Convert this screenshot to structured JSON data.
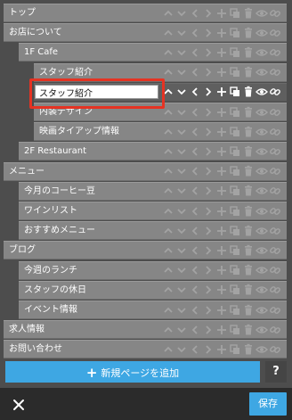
{
  "tree": [
    {
      "label": "トップ",
      "indent": 0
    },
    {
      "label": "お店について",
      "indent": 0
    },
    {
      "label": "1F Cafe",
      "indent": 1
    },
    {
      "label": "スタッフ紹介",
      "indent": 2
    },
    {
      "label": "",
      "indent": 2,
      "editing": true
    },
    {
      "label": "内装デザイン",
      "indent": 2
    },
    {
      "label": "映画タイアップ情報",
      "indent": 2
    },
    {
      "label": "2F Restaurant",
      "indent": 1
    },
    {
      "label": "メニュー",
      "indent": 0
    },
    {
      "label": "今月のコーヒー豆",
      "indent": 1
    },
    {
      "label": "ワインリスト",
      "indent": 1
    },
    {
      "label": "おすすめメニュー",
      "indent": 1
    },
    {
      "label": "ブログ",
      "indent": 0
    },
    {
      "label": "今週のランチ",
      "indent": 1
    },
    {
      "label": "スタッフの休日",
      "indent": 1
    },
    {
      "label": "イベント情報",
      "indent": 1
    },
    {
      "label": "求人情報",
      "indent": 0
    },
    {
      "label": "お問い合わせ",
      "indent": 0
    }
  ],
  "edit": {
    "value": "スタッフ紹介"
  },
  "actions": {
    "add_page_label": "新規ページを追加",
    "help_label": "?",
    "save_label": "保存"
  },
  "colors": {
    "accent": "#3ea7e3",
    "highlight": "#e53323",
    "row_bg": "#868686",
    "panel_bg": "#4d4d4d",
    "footer_bg": "#2b2b2b"
  },
  "icons": [
    "chevron-up-icon",
    "chevron-down-icon",
    "chevron-left-icon",
    "chevron-right-icon",
    "plus-icon",
    "copy-icon",
    "trash-icon",
    "eye-icon",
    "link-icon",
    "close-icon"
  ]
}
